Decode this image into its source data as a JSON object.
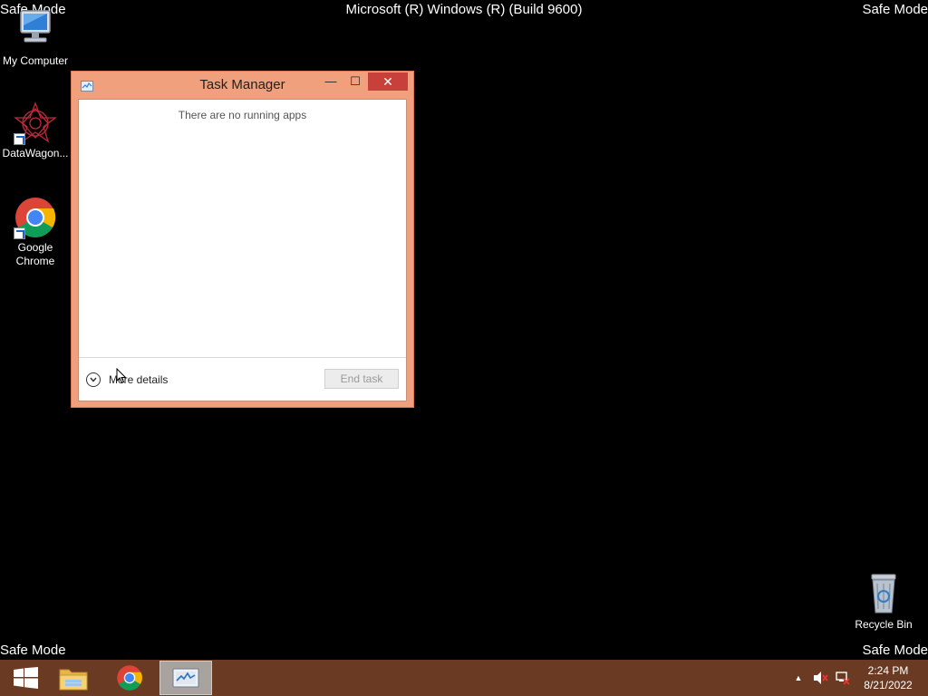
{
  "watermark": {
    "safe_mode": "Safe Mode",
    "build": "Microsoft (R) Windows (R) (Build 9600)"
  },
  "desktop_icons": [
    {
      "label": "My Computer",
      "icon": "computer-icon"
    },
    {
      "label": "DataWagon...",
      "icon": "datawagon-icon"
    },
    {
      "label": "Google Chrome",
      "icon": "chrome-icon"
    },
    {
      "label": "Recycle Bin",
      "icon": "recycle-bin-icon"
    }
  ],
  "task_manager": {
    "title": "Task Manager",
    "message": "There are no running apps",
    "more_details": "More details",
    "end_task": "End task",
    "minimize_glyph": "—",
    "maximize_glyph": "☐",
    "close_glyph": "✕"
  },
  "taskbar": {
    "items": [
      {
        "name": "start-button",
        "icon": "windows-logo-icon"
      },
      {
        "name": "file-explorer",
        "icon": "folder-icon"
      },
      {
        "name": "google-chrome",
        "icon": "chrome-icon"
      },
      {
        "name": "task-manager",
        "icon": "task-manager-icon",
        "active": true
      }
    ],
    "tray": {
      "show_hidden_glyph": "▲",
      "time": "2:24 PM",
      "date": "8/21/2022"
    }
  },
  "colors": {
    "desktop": "#000000",
    "taskbar": "#6b3a22",
    "window_frame": "#f0a07c",
    "close_button": "#c7403a"
  }
}
